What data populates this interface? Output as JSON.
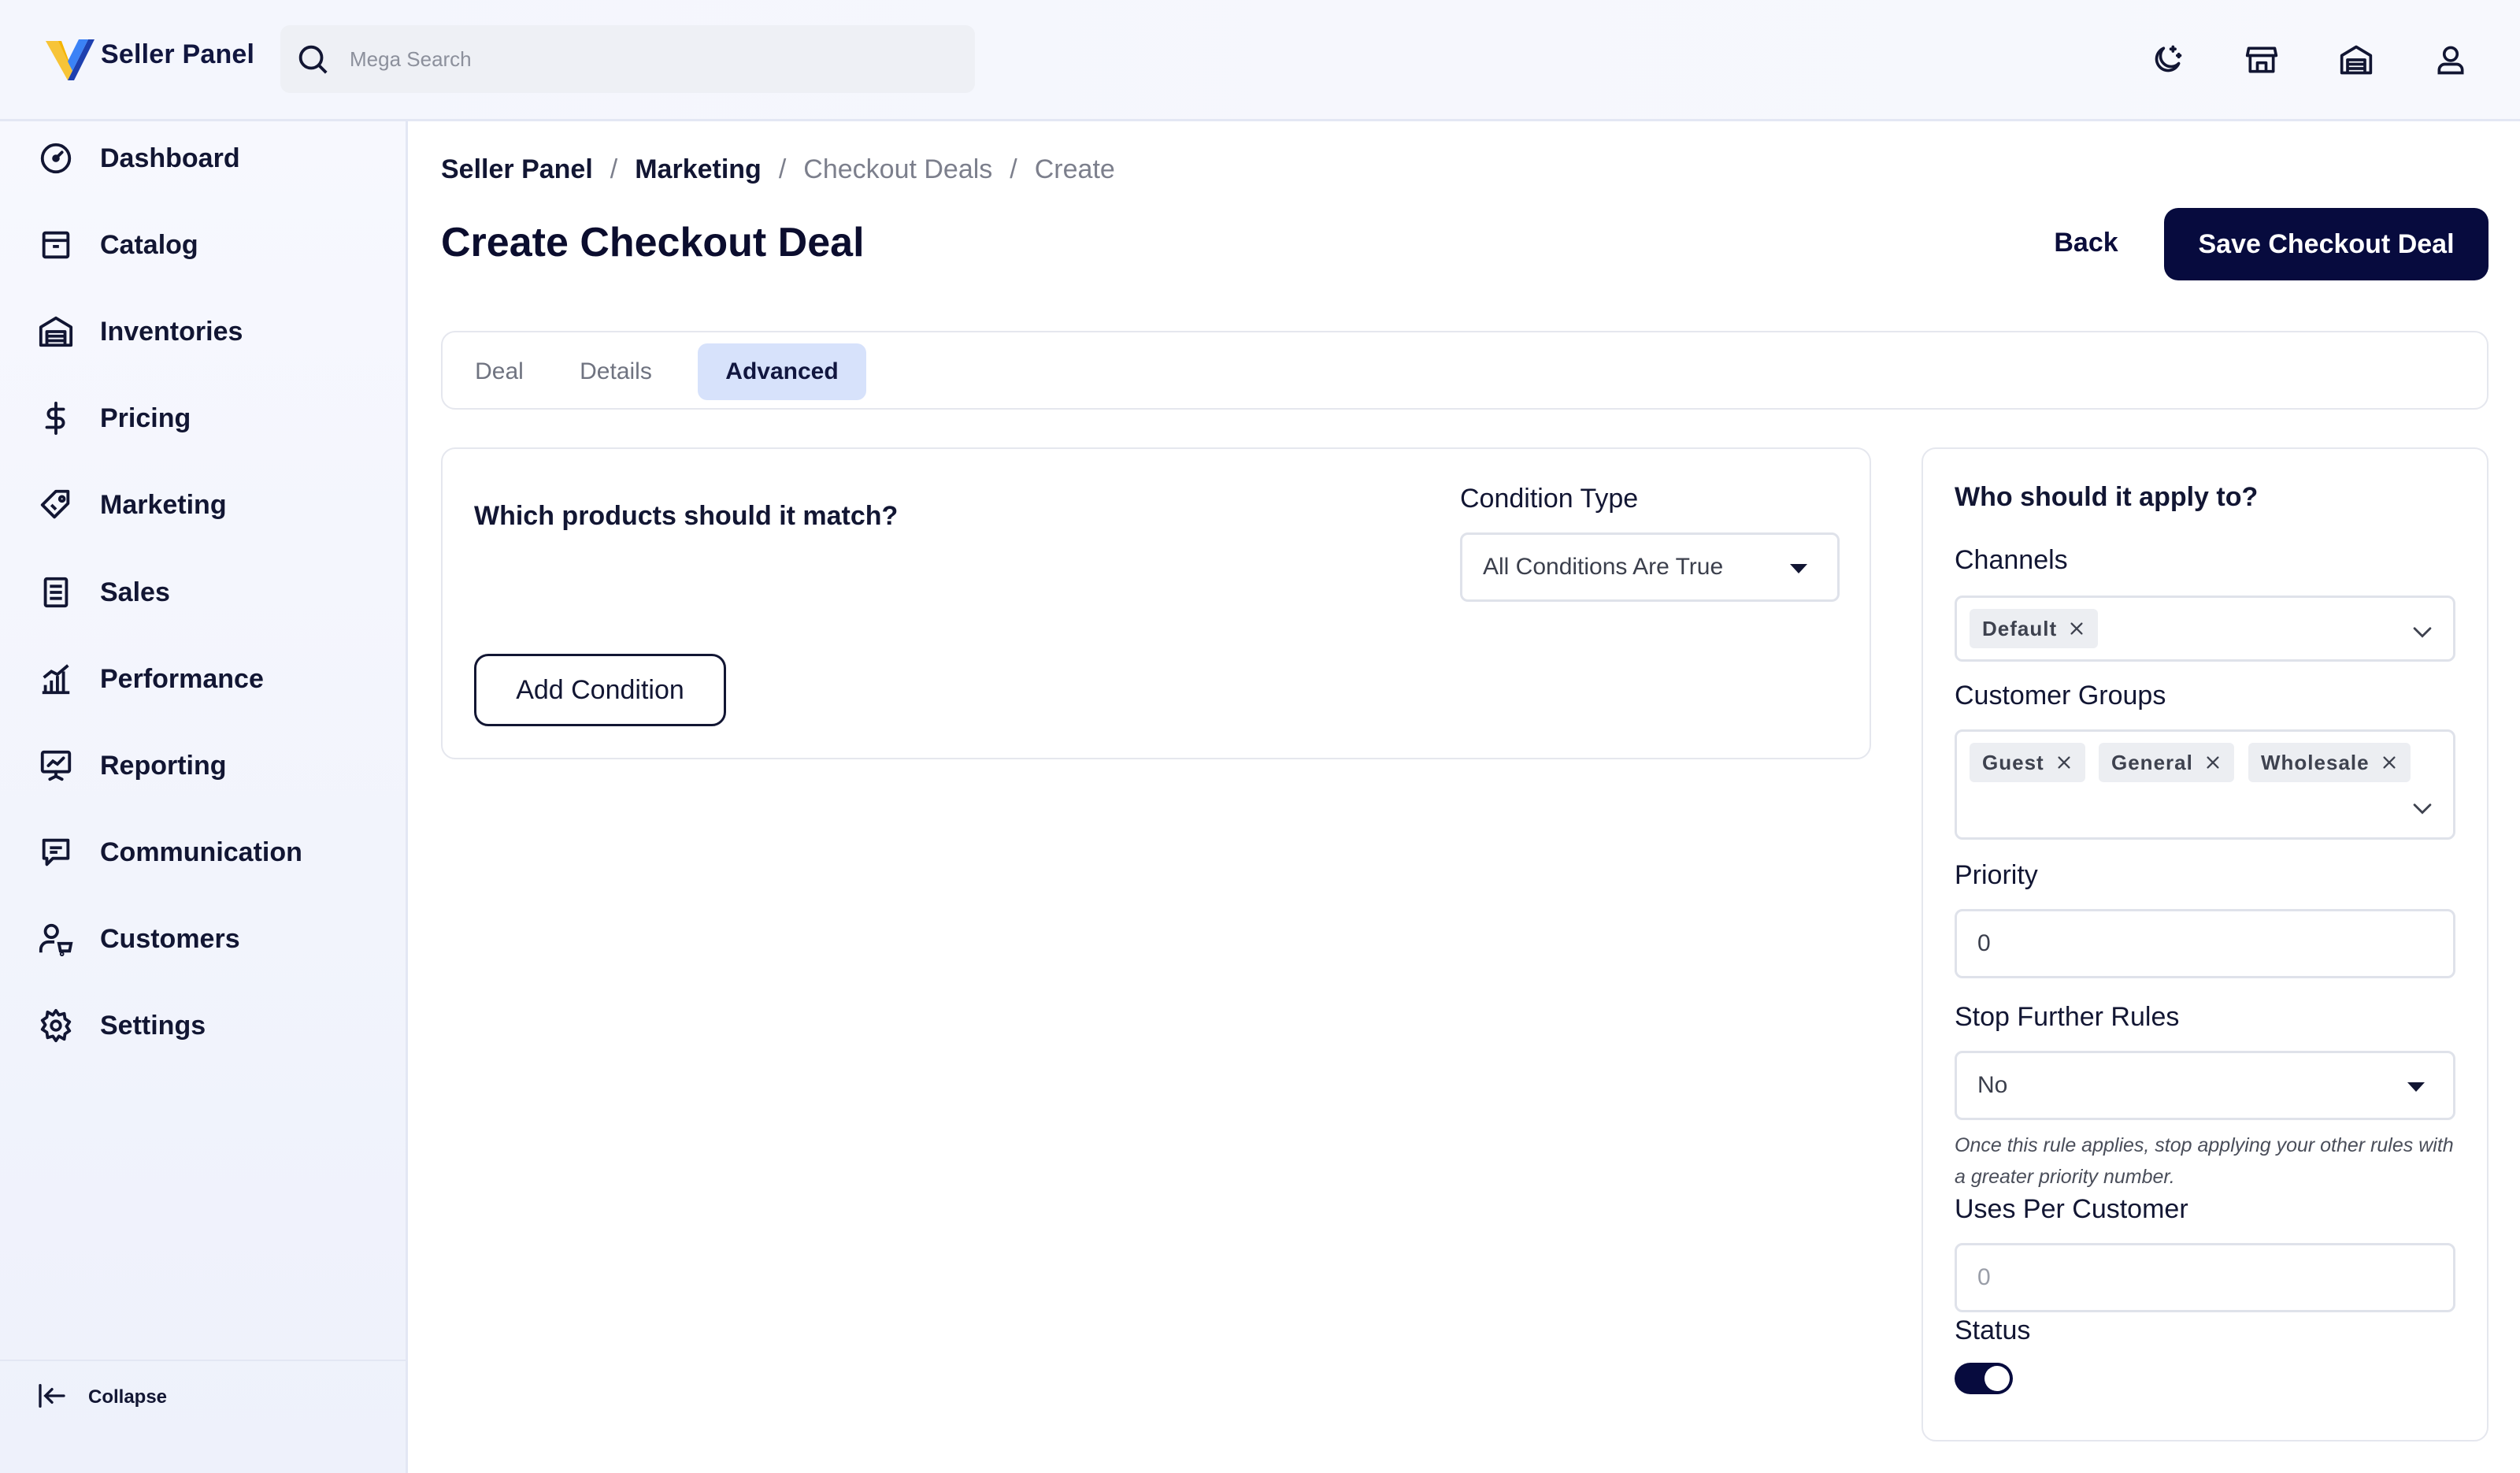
{
  "app": {
    "brand": "Seller Panel"
  },
  "search": {
    "placeholder": "Mega Search"
  },
  "top_icons": [
    "theme-moon-icon",
    "storefront-icon",
    "warehouse-icon",
    "user-icon"
  ],
  "sidebar": {
    "items": [
      {
        "label": "Dashboard",
        "icon": "dashboard-gauge-icon"
      },
      {
        "label": "Catalog",
        "icon": "catalog-box-icon"
      },
      {
        "label": "Inventories",
        "icon": "inventory-warehouse-icon"
      },
      {
        "label": "Pricing",
        "icon": "dollar-icon"
      },
      {
        "label": "Marketing",
        "icon": "tag-icon"
      },
      {
        "label": "Sales",
        "icon": "receipt-icon"
      },
      {
        "label": "Performance",
        "icon": "bar-chart-icon"
      },
      {
        "label": "Reporting",
        "icon": "presentation-icon"
      },
      {
        "label": "Communication",
        "icon": "chat-icon"
      },
      {
        "label": "Customers",
        "icon": "customers-icon"
      },
      {
        "label": "Settings",
        "icon": "gear-icon"
      }
    ],
    "collapse_label": "Collapse"
  },
  "breadcrumb": {
    "items": [
      "Seller Panel",
      "Marketing",
      "Checkout Deals",
      "Create"
    ],
    "separator": "/"
  },
  "page": {
    "title": "Create Checkout Deal",
    "back_label": "Back",
    "save_label": "Save Checkout Deal"
  },
  "tabs": [
    {
      "label": "Deal",
      "active": false
    },
    {
      "label": "Details",
      "active": false
    },
    {
      "label": "Advanced",
      "active": true
    }
  ],
  "conditions": {
    "heading": "Which products should it match?",
    "condition_type_label": "Condition Type",
    "condition_type_value": "All Conditions Are True",
    "add_condition_label": "Add Condition"
  },
  "apply": {
    "heading": "Who should it apply to?",
    "channels_label": "Channels",
    "channels": [
      "Default"
    ],
    "customer_groups_label": "Customer Groups",
    "customer_groups": [
      "Guest",
      "General",
      "Wholesale"
    ],
    "priority_label": "Priority",
    "priority_value": "0",
    "stop_rules_label": "Stop Further Rules",
    "stop_rules_value": "No",
    "stop_rules_help": "Once this rule applies, stop applying your other rules with a greater priority number.",
    "uses_label": "Uses Per Customer",
    "uses_placeholder": "0",
    "status_label": "Status",
    "status_on": true
  },
  "colors": {
    "primary": "#070b3e",
    "tab_active_bg": "#d7e2fb",
    "accent_yellow": "#f5b400"
  }
}
